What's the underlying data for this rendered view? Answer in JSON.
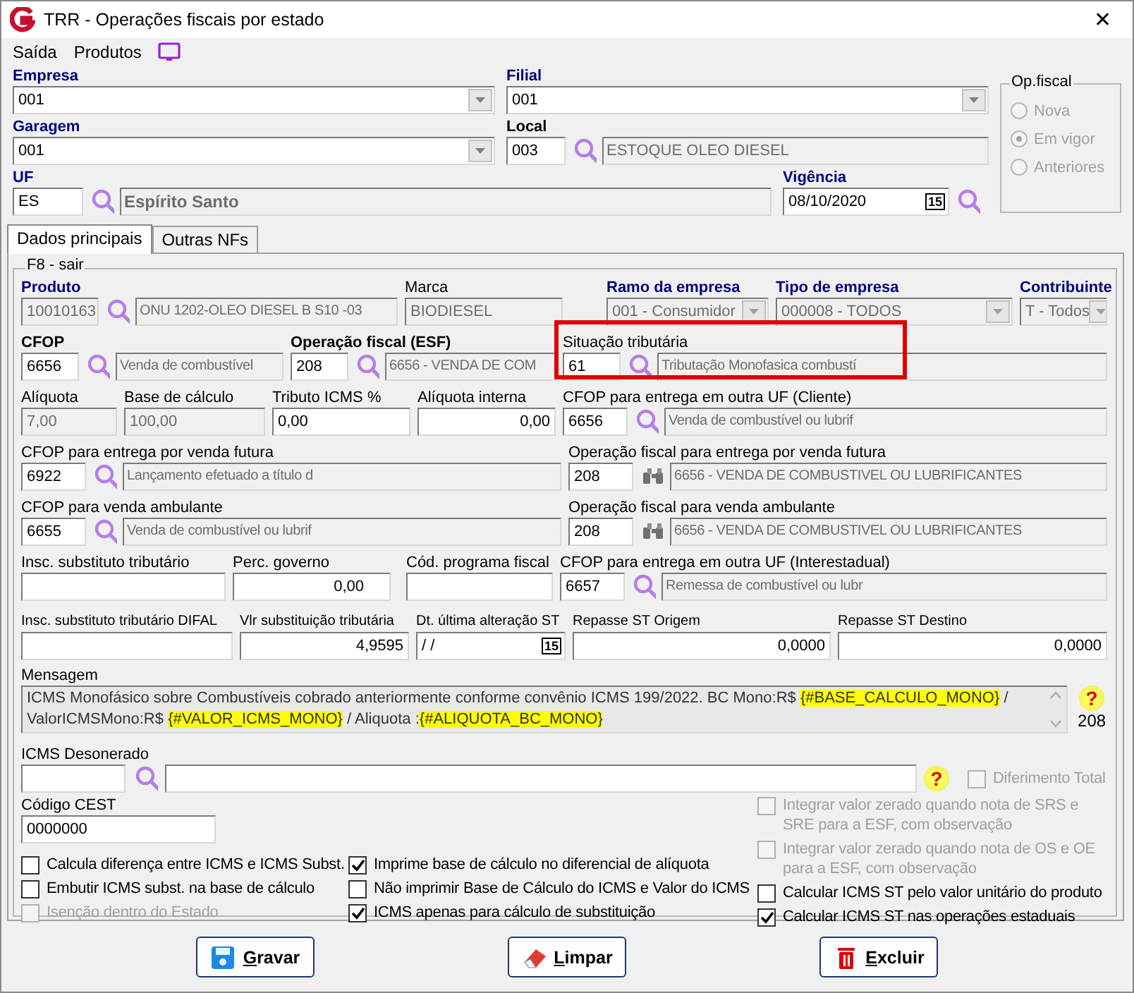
{
  "window": {
    "title": "TRR - Operações fiscais por estado",
    "close": "✕"
  },
  "menu": [
    {
      "label": "Saída"
    },
    {
      "label": "Produtos"
    }
  ],
  "header": {
    "rows": [
      [
        {
          "label": "Empresa",
          "required": true,
          "bold": true,
          "kind": "combo",
          "value": "001",
          "disabled": false
        },
        {
          "label": "Filial",
          "required": true,
          "bold": true,
          "kind": "combo",
          "value": "001",
          "disabled": false
        }
      ],
      [
        {
          "label": "Garagem",
          "required": true,
          "bold": true,
          "kind": "combo",
          "value": "001",
          "disabled": false
        },
        {
          "label": "Local",
          "required": false,
          "bold": true,
          "kind": "lookup",
          "code": "003",
          "code_readonly": false,
          "description": "ESTOQUE OLEO DIESEL"
        }
      ],
      [
        {
          "label": "UF",
          "required": true,
          "bold": true,
          "kind": "lookup",
          "code": "ES",
          "code_readonly": false,
          "description": "Espírito Santo"
        },
        {
          "label": "Vigência",
          "required": true,
          "bold": true,
          "kind": "date_search",
          "value": "08/10/2020",
          "calendar": "15"
        }
      ]
    ],
    "op_fiscal": {
      "title": "Op.fiscal",
      "disabled": true,
      "options": [
        {
          "label": "Nova",
          "selected": false
        },
        {
          "label": "Em vigor",
          "selected": true
        },
        {
          "label": "Anteriores",
          "selected": false
        }
      ]
    }
  },
  "tabs": [
    {
      "label": "Dados principais",
      "selected": true
    },
    {
      "label": "Outras NFs",
      "selected": false
    }
  ],
  "group": {
    "title": "F8 - sair",
    "fields": [
      {
        "label": "Produto",
        "required": true,
        "bold": true,
        "kind": "lookup",
        "code": "10010163",
        "code_readonly": true,
        "description": "ONU 1202-OLEO DIESEL B S10 -03"
      },
      {
        "label": "Marca",
        "required": false,
        "bold": false,
        "kind": "text",
        "value": "BIODIESEL",
        "readonly": true
      },
      {
        "label": "Ramo da empresa",
        "required": true,
        "bold": true,
        "kind": "combo",
        "value": "001 - Consumidor",
        "disabled": true
      },
      {
        "label": "Tipo de empresa",
        "required": true,
        "bold": true,
        "kind": "combo",
        "value": "000008 - TODOS",
        "disabled": true
      },
      {
        "label": "Contribuinte",
        "required": true,
        "bold": true,
        "kind": "combo",
        "value": "T - Todos",
        "disabled": true
      },
      {
        "label": "CFOP",
        "required": false,
        "bold": true,
        "kind": "lookup",
        "code": "6656",
        "code_readonly": false,
        "description": "Venda de combustível"
      },
      {
        "label": "Operação fiscal (ESF)",
        "required": false,
        "bold": true,
        "kind": "lookup",
        "code": "208",
        "code_readonly": false,
        "description": "6656 - VENDA DE COM"
      },
      {
        "label": "Situação tributária",
        "required": false,
        "bold": false,
        "kind": "lookup",
        "code": "61",
        "code_readonly": false,
        "description": "Tributação Monofasica combustí",
        "highlighted": true
      },
      {
        "label": "Alíquota",
        "required": false,
        "bold": false,
        "kind": "text",
        "value": "7,00",
        "readonly": true
      },
      {
        "label": "Base de cálculo",
        "required": false,
        "bold": false,
        "kind": "text",
        "value": "100,00",
        "readonly": true
      },
      {
        "label": "Tributo ICMS %",
        "required": false,
        "bold": false,
        "kind": "text",
        "value": "0,00",
        "readonly": false
      },
      {
        "label": "Alíquota interna",
        "required": false,
        "bold": false,
        "kind": "number",
        "value": "0,00",
        "readonly": false
      },
      {
        "label": "CFOP para entrega em outra UF (Cliente)",
        "required": false,
        "bold": false,
        "kind": "lookup",
        "code": "6656",
        "code_readonly": false,
        "description": "Venda de combustível ou lubrif"
      },
      {
        "label": "CFOP para entrega por venda futura",
        "required": false,
        "bold": false,
        "kind": "lookup",
        "code": "6922",
        "code_readonly": false,
        "description": "Lançamento efetuado a título d"
      },
      {
        "label": "Operação fiscal para entrega por venda futura",
        "required": false,
        "bold": false,
        "kind": "op_lookup",
        "code": "208",
        "code_readonly": false,
        "description": "6656 - VENDA DE COMBUSTIVEL OU LUBRIFICANTES"
      },
      {
        "label": "CFOP para venda ambulante",
        "required": false,
        "bold": false,
        "kind": "lookup",
        "code": "6655",
        "code_readonly": false,
        "description": "Venda de combustível ou lubrif"
      },
      {
        "label": "Operação fiscal para venda ambulante",
        "required": false,
        "bold": false,
        "kind": "op_lookup",
        "code": "208",
        "code_readonly": false,
        "description": "6656 - VENDA DE COMBUSTIVEL OU LUBRIFICANTES"
      },
      {
        "label": "Insc. substituto tributário",
        "required": false,
        "bold": false,
        "kind": "text",
        "readonly": false
      },
      {
        "label": "Perc. governo",
        "required": false,
        "bold": false,
        "kind": "number",
        "value": "0,00",
        "readonly": false
      },
      {
        "label": "Cód. programa fiscal",
        "required": false,
        "bold": false,
        "kind": "text",
        "readonly": false
      },
      {
        "label": "CFOP para entrega em outra UF (Interestadual)",
        "required": false,
        "bold": false,
        "kind": "lookup",
        "code": "6657",
        "code_readonly": false,
        "description": "Remessa de combustível ou lubr"
      },
      {
        "label": "Insc. substituto tributário DIFAL",
        "required": false,
        "bold": false,
        "kind": "text",
        "readonly": false
      },
      {
        "label": "Vlr substituição tributária",
        "required": false,
        "bold": false,
        "kind": "number",
        "value": "4,9595",
        "readonly": false
      },
      {
        "label": "Dt. última alteração ST",
        "required": false,
        "bold": false,
        "kind": "date",
        "value": "/ /",
        "calendar": "15"
      },
      {
        "label": "Repasse ST Origem",
        "required": false,
        "bold": false,
        "kind": "number",
        "value": "0,0000",
        "readonly": false
      },
      {
        "label": "Repasse ST Destino",
        "required": false,
        "bold": false,
        "kind": "number",
        "value": "0,0000",
        "readonly": false
      }
    ],
    "message": {
      "label": "Mensagem",
      "segments": [
        {
          "text": "ICMS Monofásico sobre Combustíveis cobrado anteriormente conforme convênio ICMS 199/2022. BC Mono:R$ ",
          "highlighted": false
        },
        {
          "text": "{#BASE_CALCULO_MONO}",
          "highlighted": true
        },
        {
          "text": " / ValorICMSMono:R$ ",
          "highlighted": false
        },
        {
          "text": "{#VALOR_ICMS_MONO}",
          "highlighted": true
        },
        {
          "text": " / Aliquota :",
          "highlighted": false
        },
        {
          "text": "{#ALIQUOTA_BC_MONO}",
          "highlighted": true
        }
      ],
      "help": "?",
      "count": "208"
    },
    "desonerado": {
      "label": "ICMS Desonerado",
      "help": "?",
      "option": {
        "label": "Diferimento Total",
        "checked": false,
        "disabled": true
      }
    },
    "cest": {
      "label": "Código CEST",
      "value": "0000000"
    },
    "checks_left": [
      {
        "label": "Calcula diferença entre ICMS e ICMS Subst.",
        "checked": false,
        "disabled": false
      },
      {
        "label": "Imprime base de cálculo no diferencial de alíquota",
        "checked": true,
        "disabled": false
      },
      {
        "label": "Embutir ICMS subst. na base de cálculo",
        "checked": false,
        "disabled": false
      },
      {
        "label": "Não imprimir Base de Cálculo do ICMS e Valor do ICMS",
        "checked": false,
        "disabled": false
      },
      {
        "label": "Isenção dentro do Estado",
        "checked": false,
        "disabled": true
      },
      {
        "label": "ICMS apenas para cálculo de substituição",
        "checked": true,
        "disabled": false
      }
    ],
    "checks_right": [
      {
        "label": "Integrar valor zerado quando nota de SRS e SRE para a ESF, com observação",
        "checked": false,
        "disabled": true
      },
      {
        "label": "Integrar valor zerado quando nota de OS e OE para a ESF, com observação",
        "checked": false,
        "disabled": true
      },
      {
        "label": "Calcular ICMS ST pelo valor unitário do produto",
        "checked": false,
        "disabled": false
      },
      {
        "label": "Calcular ICMS ST nas operações estaduais",
        "checked": true,
        "disabled": false
      }
    ]
  },
  "buttons": [
    {
      "kind": "save",
      "accel": "G",
      "rest": "ravar"
    },
    {
      "kind": "clear",
      "accel": "L",
      "rest": "impar"
    },
    {
      "kind": "delete",
      "accel": "E",
      "rest": "xcluir"
    }
  ]
}
